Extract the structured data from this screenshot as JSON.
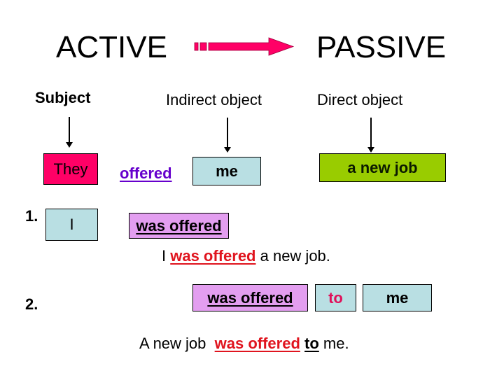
{
  "header": {
    "active_label": "ACTIVE",
    "passive_label": "PASSIVE",
    "arrow_icon": "right-arrow-icon",
    "arrow_color": "#ff0066"
  },
  "columns": {
    "subject": "Subject",
    "indirect_object": "Indirect object",
    "direct_object": "Direct object"
  },
  "active_sentence": {
    "subject": "They",
    "verb": "offered",
    "indirect_object": "me",
    "direct_object": "a new job"
  },
  "example1": {
    "number": "1.",
    "subject": "I",
    "verb": "was offered",
    "sentence": {
      "pre": "I ",
      "verb": "was offered",
      "post": " a new job."
    }
  },
  "example2": {
    "number": "2.",
    "verb": "was offered",
    "preposition": "to",
    "object": "me",
    "sentence": {
      "pre": "A new job  ",
      "verb": "was offered",
      "space": " ",
      "preposition": "to",
      "post": " me."
    }
  },
  "colors": {
    "pink": "#ff0066",
    "light_blue": "#b9dfe3",
    "green": "#99cc00",
    "violet": "#e39ef0",
    "red_text": "#e0141e",
    "verb_purple": "#6600cc",
    "to_pink": "#e0105a"
  }
}
